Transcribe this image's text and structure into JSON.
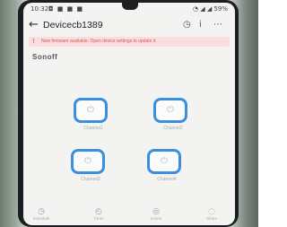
{
  "status_bar": {
    "time": "10:32",
    "icons": "◘ ■ ■ ■",
    "right": "◔ ◢ ◢ 59%"
  },
  "header": {
    "title": "Devicecb1389",
    "icons": [
      "timer-icon",
      "info-icon",
      "more-icon"
    ]
  },
  "banner": {
    "text": "New firmware available. Open device settings to update it."
  },
  "brand": {
    "logo": "Sonoff"
  },
  "switches": [
    {
      "label": "Channel1"
    },
    {
      "label": "Channel2"
    },
    {
      "label": "Channel3"
    },
    {
      "label": "Channel4"
    }
  ],
  "bottom_nav": [
    {
      "label": "Schedule",
      "icon": "clock-icon"
    },
    {
      "label": "Timer",
      "icon": "timer-icon"
    },
    {
      "label": "Scene",
      "icon": "scene-icon"
    },
    {
      "label": "Share",
      "icon": "share-icon"
    }
  ],
  "colors": {
    "accent": "#3b8ee0",
    "banner_bg": "#f8dede",
    "screen_bg": "#f3f4f2"
  }
}
